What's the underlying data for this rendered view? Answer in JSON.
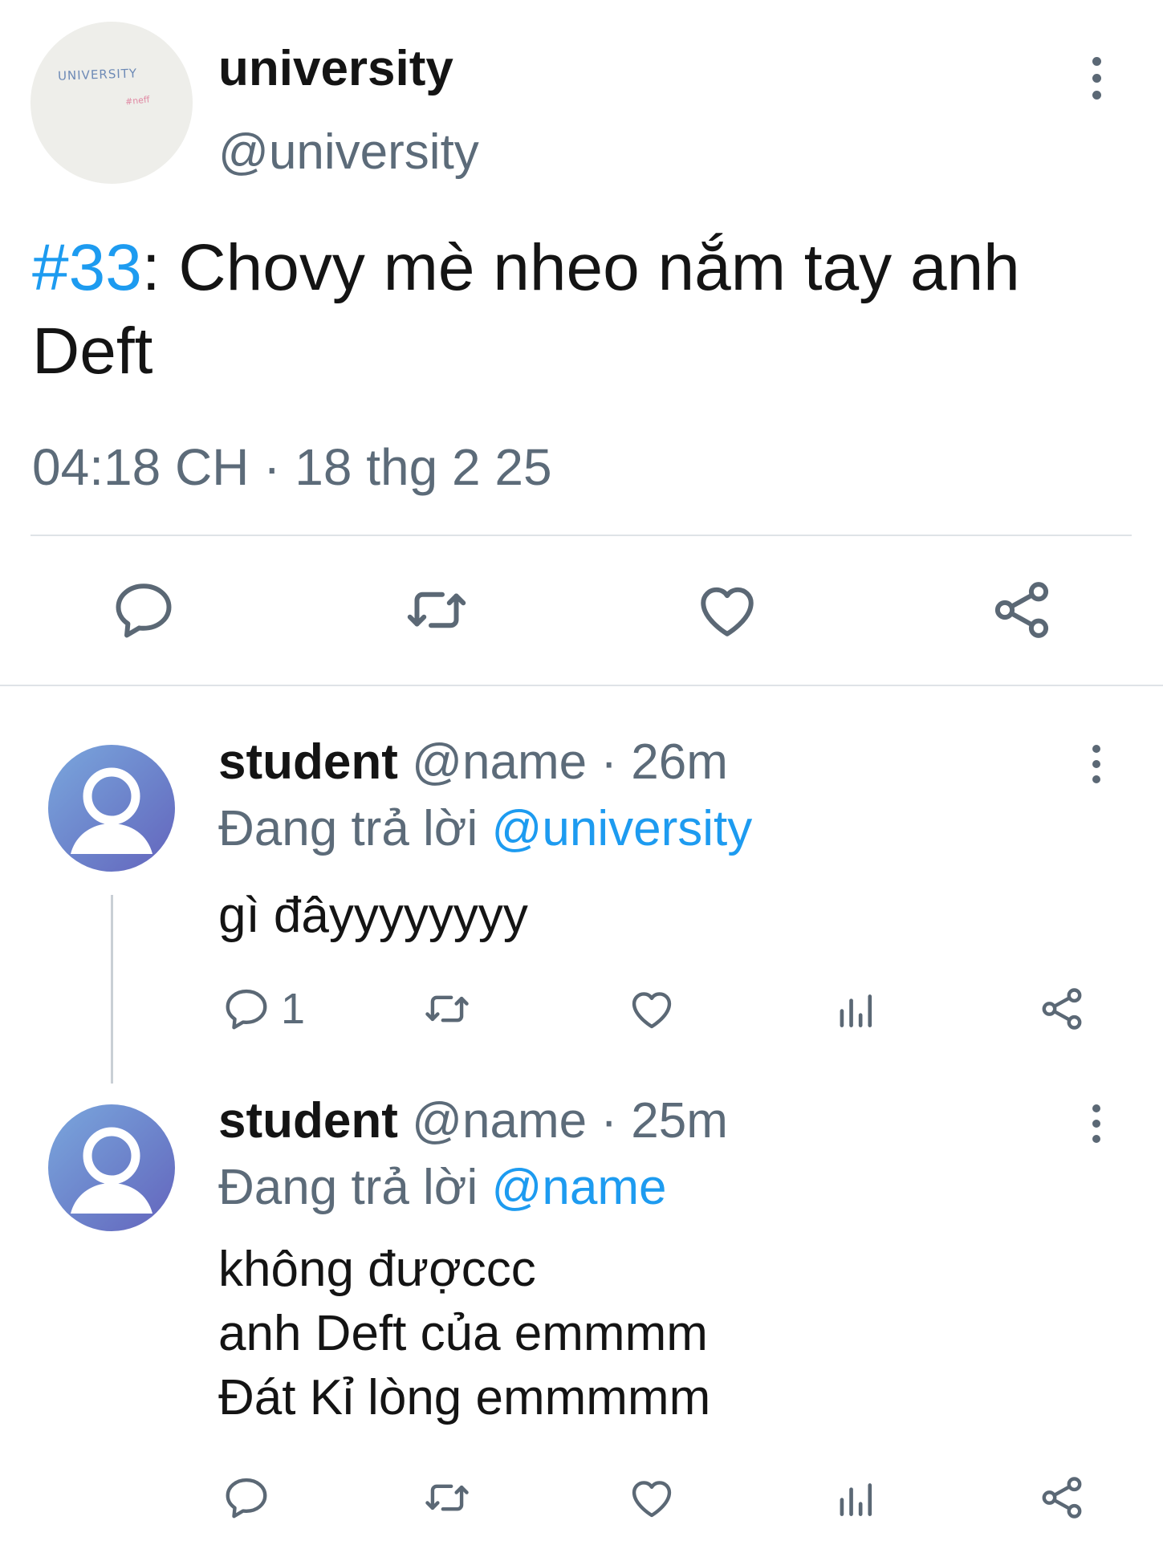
{
  "main_tweet": {
    "avatar": {
      "logo_text": "UNIVERSITY",
      "logo_tag": "#neff"
    },
    "display_name": "university",
    "handle": "@university",
    "hashtag": "#33",
    "text": ": Chovy mè nheo nắm tay anh Deft",
    "timestamp": "04:18 CH · 18 thg 2 25",
    "actions": [
      "reply-icon",
      "retweet-icon",
      "like-icon",
      "share-icon"
    ]
  },
  "replies": [
    {
      "display_name": "student",
      "meta": " @name · 26m",
      "replying_prefix": "Đang trả lời ",
      "replying_to": "@university",
      "text": "gì đâyyyyyyyy",
      "reply_count": "1",
      "actions": [
        "reply-icon",
        "retweet-icon",
        "like-icon",
        "views-icon",
        "share-icon"
      ]
    },
    {
      "display_name": "student",
      "meta": " @name · 25m",
      "replying_prefix": "Đang trả lời ",
      "replying_to": "@name",
      "lines": [
        "không đượccc",
        "anh Deft của emmmm",
        "Đát Kỉ lòng emmmmm"
      ],
      "actions": [
        "reply-icon",
        "retweet-icon",
        "like-icon",
        "views-icon",
        "share-icon"
      ]
    }
  ],
  "colors": {
    "accent": "#1d9bf0",
    "secondary_text": "#5c6b79",
    "icon": "#5b6875",
    "divider": "#dfe3e7"
  }
}
